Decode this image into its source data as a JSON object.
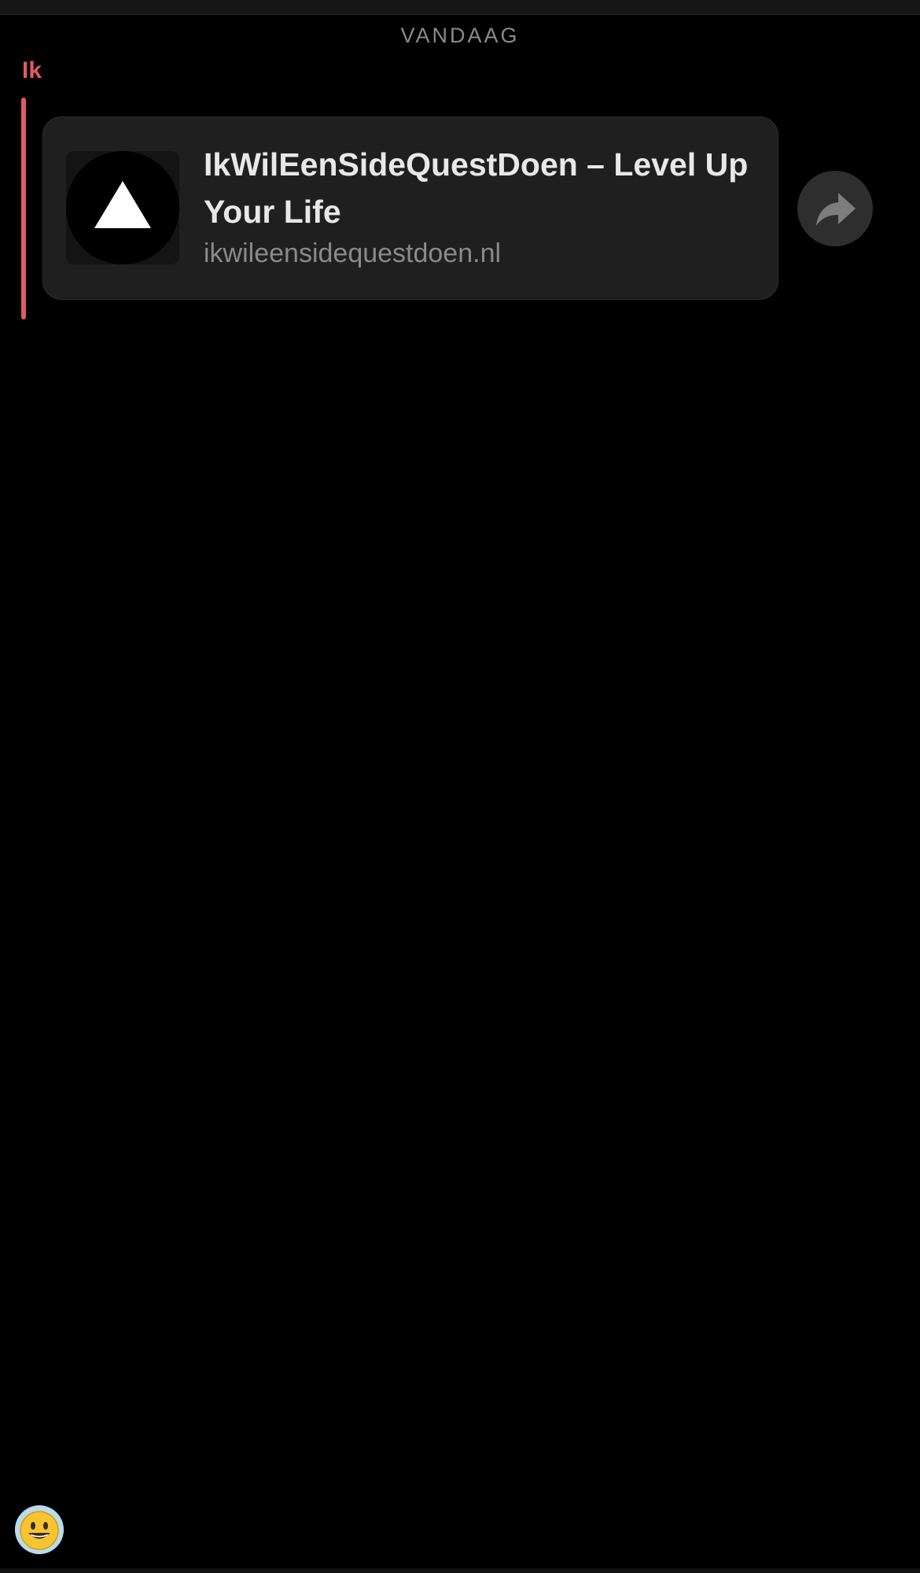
{
  "chat": {
    "date_divider": "VANDAAG",
    "sender": "Ik",
    "accent_color": "#e05a67",
    "messages": [
      {
        "type": "link-preview",
        "title": "IkWilEenSideQuestDoen – Level Up Your Life",
        "domain": "ikwileensidequestdoen.nl",
        "thumbnail_icon": "white-triangle-logo"
      }
    ]
  },
  "actions": {
    "share_icon": "share-arrow-icon",
    "emoji_icon": "smiley-emoji-icon"
  }
}
